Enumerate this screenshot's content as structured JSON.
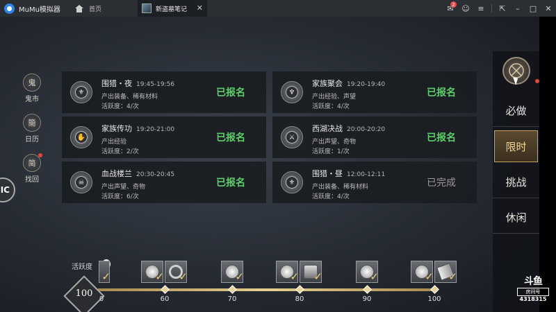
{
  "emulator": {
    "brand": "MuMu模拟器",
    "home_tab": "首页",
    "game_tab": "新盗墓笔记",
    "notification_count": "2"
  },
  "left_menu": [
    {
      "label": "鬼市",
      "icon": "鬼"
    },
    {
      "label": "日历",
      "icon": "簡"
    },
    {
      "label": "找回",
      "icon": "简"
    }
  ],
  "edge_circle_text": "IC",
  "events": [
    {
      "title": "围猎・夜",
      "time": "19:45-19:56",
      "output": "产出装备、稀有材料",
      "activity": "活跃度：4/次",
      "status": "已报名",
      "done": false
    },
    {
      "title": "家族聚会",
      "time": "19:20-19:40",
      "output": "产出经验、声望",
      "activity": "活跃度：4/次",
      "status": "已报名",
      "done": false
    },
    {
      "title": "家族传功",
      "time": "19:20-21:00",
      "output": "产出经验",
      "activity": "活跃度：2/次",
      "status": "已报名",
      "done": false
    },
    {
      "title": "西湖决战",
      "time": "20:00-20:20",
      "output": "产出声望、奇物",
      "activity": "活跃度：1/次",
      "status": "已报名",
      "done": false
    },
    {
      "title": "血战楼兰",
      "time": "20:30-20:45",
      "output": "产出声望、奇物",
      "activity": "活跃度：6/次",
      "status": "已报名",
      "done": false
    },
    {
      "title": "围猎・昼",
      "time": "12:00-12:11",
      "output": "产出装备、稀有材料",
      "activity": "活跃度：4/次",
      "status": "已完成",
      "done": true
    }
  ],
  "categories": [
    {
      "label": "必做",
      "active": false
    },
    {
      "label": "限时",
      "active": true
    },
    {
      "label": "挑战",
      "active": false
    },
    {
      "label": "休闲",
      "active": false
    }
  ],
  "activity": {
    "label": "活跃度",
    "warn": "!",
    "score": "100",
    "first_tick_partial": "0",
    "ticks": [
      "60",
      "70",
      "80",
      "90",
      "100"
    ]
  },
  "watermark": {
    "logo": "斗鱼",
    "room_label": "房间号",
    "room_number": "4318315"
  },
  "colors": {
    "registered": "#5ccf6a",
    "done": "#9a9a9a",
    "active_category": "#f2d79a",
    "progress_gold": "#e6cf8f"
  }
}
